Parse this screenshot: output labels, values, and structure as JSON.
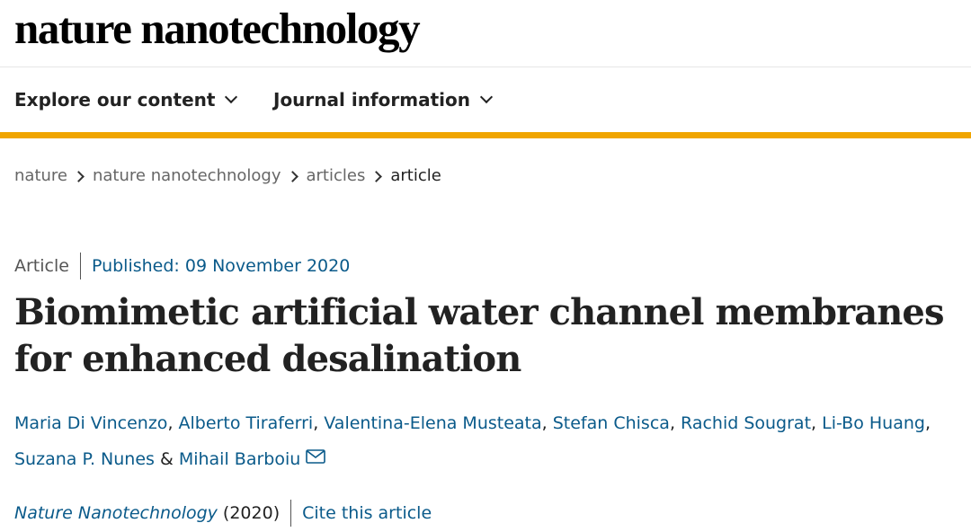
{
  "site": {
    "logo": "nature nanotechnology"
  },
  "nav": {
    "items": [
      {
        "label": "Explore our content",
        "icon": "chevron-down-icon"
      },
      {
        "label": "Journal information",
        "icon": "chevron-down-icon"
      }
    ],
    "accent_color": "#f0a500"
  },
  "breadcrumb": {
    "items": [
      "nature",
      "nature nanotechnology",
      "articles",
      "article"
    ],
    "separator_icon": "chevron-right-icon"
  },
  "article": {
    "type": "Article",
    "published": "Published: 09 November 2020",
    "title": "Biomimetic artificial water channel membranes for enhanced desalination",
    "authors": [
      "Maria Di Vincenzo",
      "Alberto Tiraferri",
      "Valentina-Elena Musteata",
      "Stefan Chisca",
      "Rachid Sougrat",
      "Li-Bo Huang",
      "Suzana P. Nunes",
      "Mihail Barboiu"
    ],
    "author_joiner": "&",
    "corresponding_icon": "envelope-icon",
    "journal": "Nature Nanotechnology",
    "year": "(2020)",
    "cite_label": "Cite this article",
    "link_color": "#0a5a8a"
  }
}
